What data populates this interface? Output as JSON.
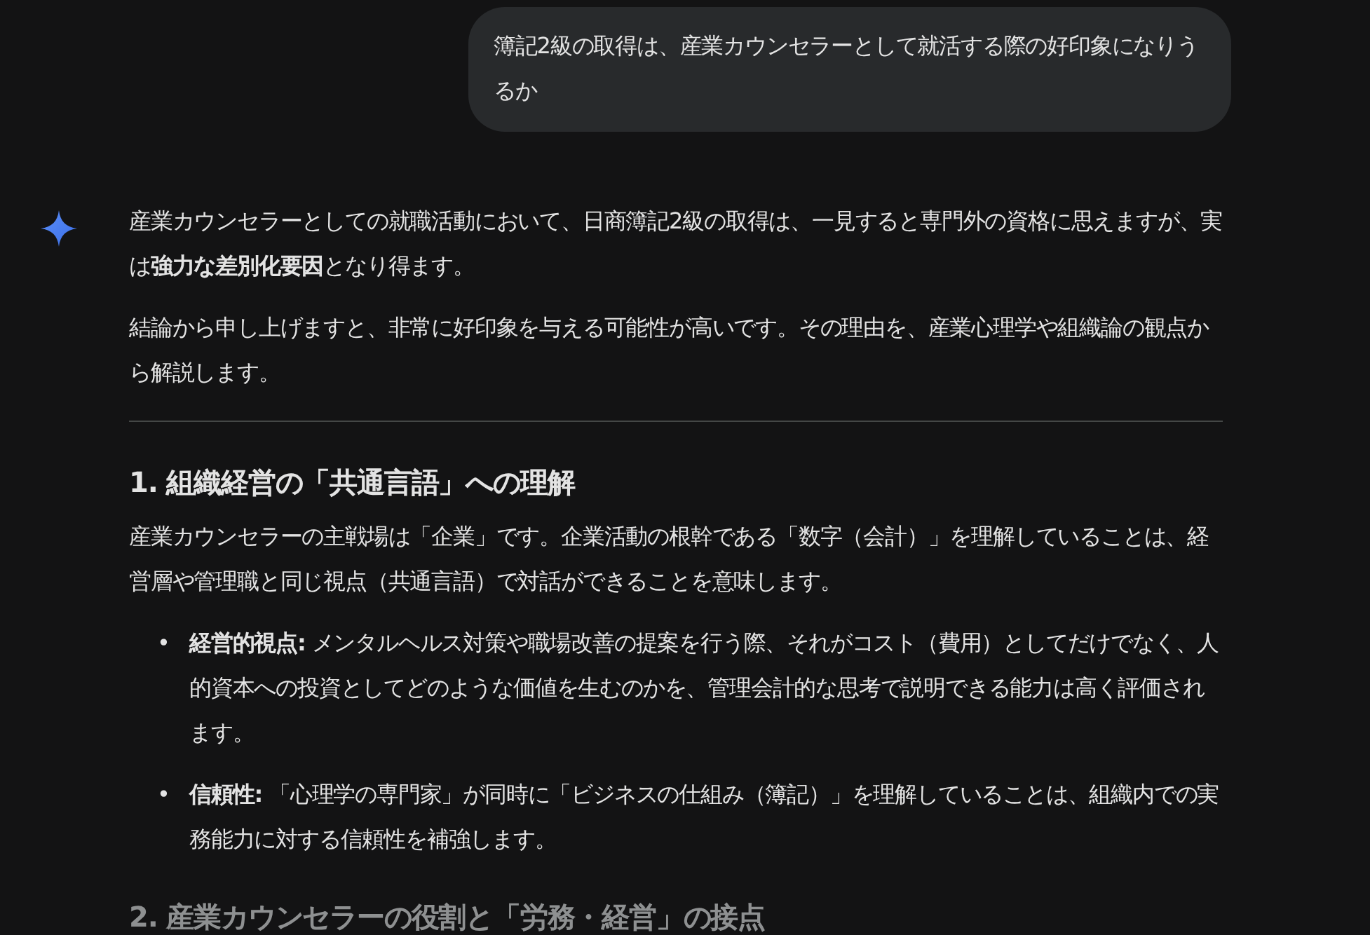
{
  "user_message": {
    "text": "簿記2級の取得は、産業カウンセラーとして就活する際の好印象になりうるか"
  },
  "response": {
    "blocks": [
      {
        "kind": "paragraph",
        "text": "産業カウンセラーとしての就職活動において、日商簿記2級の取得は、一見すると専門外の資格に思えますが、実は**強力な差別化要因**となり得ます。"
      },
      {
        "kind": "paragraph",
        "text": "結論から申し上げますと、非常に好印象を与える可能性が高いです。その理由を、産業心理学や組織論の観点から解説します。"
      },
      {
        "kind": "divider"
      },
      {
        "kind": "heading",
        "text": "1. 組織経営の「共通言語」への理解"
      },
      {
        "kind": "paragraph",
        "text": "産業カウンセラーの主戦場は「企業」です。企業活動の根幹である「数字（会計）」を理解していることは、経営層や管理職と同じ視点（共通言語）で対話ができることを意味します。"
      },
      {
        "kind": "list",
        "items": [
          {
            "marker": "•",
            "text": "**経営的視点:** メンタルヘルス対策や職場改善の提案を行う際、それがコスト（費用）としてだけでなく、人的資本への投資としてどのような価値を生むのかを、管理会計的な思考で説明できる能力は高く評価されます。"
          },
          {
            "marker": "•",
            "text": "**信頼性:** 「心理学の専門家」が同時に「ビジネスの仕組み（簿記）」を理解していることは、組織内での実務能力に対する信頼性を補強します。"
          }
        ]
      },
      {
        "kind": "heading",
        "text": "2. 産業カウンセラーの役割と「労務・経営」の接点"
      }
    ]
  }
}
